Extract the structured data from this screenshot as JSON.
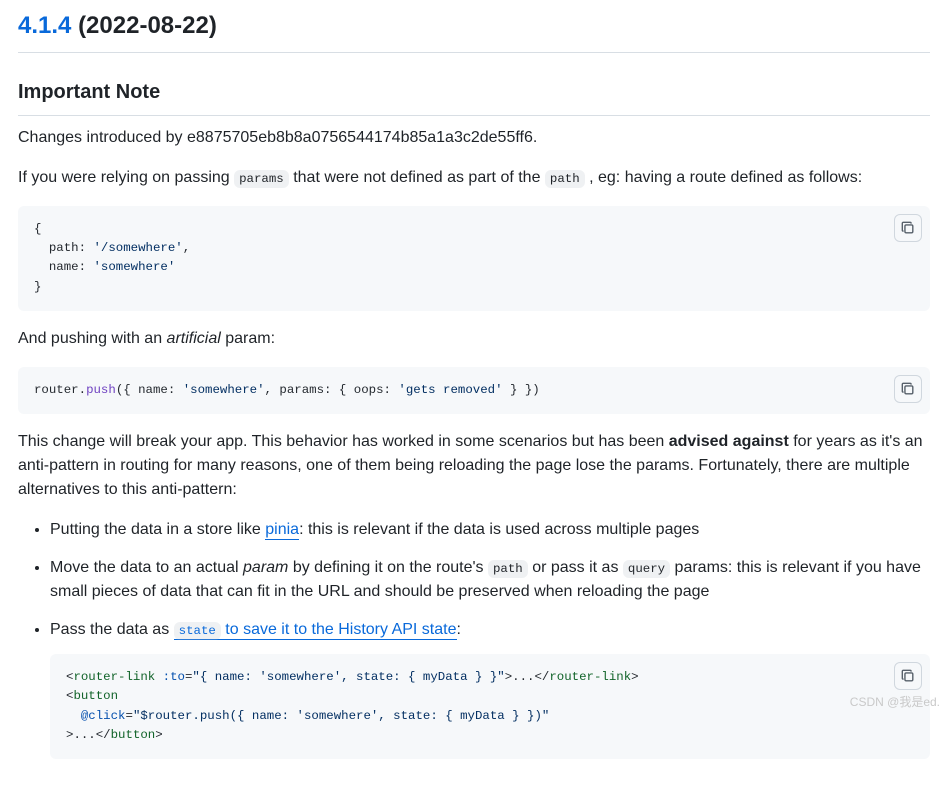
{
  "header": {
    "version": "4.1.4",
    "date": "(2022-08-22)"
  },
  "section_title": "Important Note",
  "para_intro": "Changes introduced by e8875705eb8b8a0756544174b85a1a3c2de55ff6.",
  "para_rely_pre": "If you were relying on passing ",
  "para_rely_code1": "params",
  "para_rely_mid": " that were not defined as part of the ",
  "para_rely_code2": "path",
  "para_rely_post": " , eg: having a route defined as follows:",
  "code1": {
    "l1": "{",
    "l2_a": "  path:",
    "l2_b": " '/somewhere'",
    "l2_c": ",",
    "l3_a": "  name:",
    "l3_b": " 'somewhere'",
    "l4": "}"
  },
  "para_push_pre": "And pushing with an ",
  "para_push_em": "artificial",
  "para_push_post": " param:",
  "code2": {
    "pre": "router.",
    "fn": "push",
    "mid1": "({ ",
    "k_name": "name",
    "colon1": ":",
    "v_name": " 'somewhere'",
    "comma1": ", ",
    "k_params": "params",
    "colon2": ":",
    "brace_open": " { ",
    "k_oops": "oops",
    "colon3": ":",
    "v_oops": " 'gets removed'",
    "brace_close": " } })"
  },
  "para_break_a": "This change will break your app. This behavior has worked in some scenarios but has been ",
  "para_break_strong": "advised against",
  "para_break_b": " for years as it's an anti-pattern in routing for many reasons, one of them being reloading the page lose the params. Fortunately, there are multiple alternatives to this anti-pattern:",
  "bullets": {
    "b1_a": "Putting the data in a store like ",
    "b1_link": "pinia",
    "b1_b": ": this is relevant if the data is used across multiple pages",
    "b2_a": "Move the data to an actual ",
    "b2_em": "param",
    "b2_b": " by defining it on the route's ",
    "b2_code1": "path",
    "b2_c": " or pass it as ",
    "b2_code2": "query",
    "b2_d": " params: this is relevant if you have small pieces of data that can fit in the URL and should be preserved when reloading the page",
    "b3_a": "Pass the data as ",
    "b3_code": "state",
    "b3_linktext": " to save it to the History API state",
    "b3_b": ":"
  },
  "code3": {
    "l1_open": "<",
    "l1_tag": "router-link",
    "l1_sp": " ",
    "l1_attr": ":to",
    "l1_eq": "=",
    "l1_val": "\"{ name: 'somewhere', state: { myData } }\"",
    "l1_close": ">",
    "l1_dots": "...",
    "l1_endopen": "</",
    "l1_endtag": "router-link",
    "l1_endclose": ">",
    "l2_open": "<",
    "l2_tag": "button",
    "l3_indent": "  ",
    "l3_attr": "@click",
    "l3_eq": "=",
    "l3_val": "\"$router.push({ name: 'somewhere', state: { myData } })\"",
    "l4_close": ">",
    "l4_dots": "...",
    "l4_endopen": "</",
    "l4_endtag": "button",
    "l4_endclose": ">"
  },
  "watermark": "CSDN @我是ed."
}
